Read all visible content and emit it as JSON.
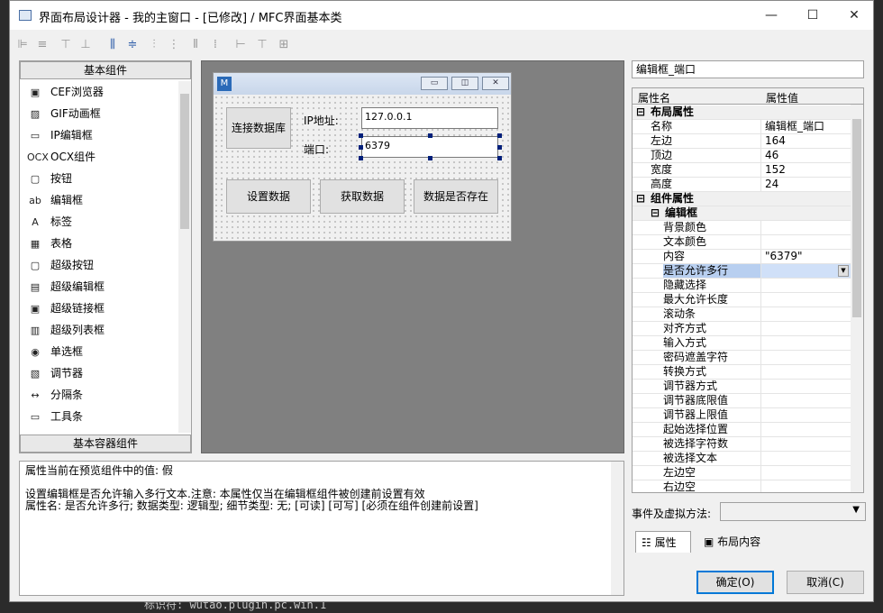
{
  "background_terminal": {
    "text": "标识符: wutao.plugin.pc.win.1"
  },
  "window": {
    "title": "界面布局设计器 - 我的主窗口 - [已修改] / MFC界面基本类"
  },
  "left_panel": {
    "header": "基本组件",
    "footer": "基本容器组件",
    "items": [
      {
        "icon": "▣",
        "label": "CEF浏览器"
      },
      {
        "icon": "▨",
        "label": "GIF动画框"
      },
      {
        "icon": "▭",
        "label": "IP编辑框"
      },
      {
        "icon": "OCX",
        "label": "OCX组件"
      },
      {
        "icon": "▢",
        "label": "按钮"
      },
      {
        "icon": "ab",
        "label": "编辑框"
      },
      {
        "icon": "A",
        "label": "标签"
      },
      {
        "icon": "▦",
        "label": "表格"
      },
      {
        "icon": "▢",
        "label": "超级按钮"
      },
      {
        "icon": "▤",
        "label": "超级编辑框"
      },
      {
        "icon": "▣",
        "label": "超级链接框"
      },
      {
        "icon": "▥",
        "label": "超级列表框"
      },
      {
        "icon": "◉",
        "label": "单选框"
      },
      {
        "icon": "▧",
        "label": "调节器"
      },
      {
        "icon": "↔",
        "label": "分隔条"
      },
      {
        "icon": "▭",
        "label": "工具条"
      }
    ]
  },
  "design_form": {
    "connect_button": "连接数据库",
    "ip_label": "IP地址:",
    "ip_value": "127.0.0.1",
    "port_label": "端口:",
    "port_value": "6379",
    "set_button": "设置数据",
    "get_button": "获取数据",
    "exists_button": "数据是否存在"
  },
  "description": {
    "line1": "属性当前在预览组件中的值: 假",
    "line2": "设置编辑框是否允许输入多行文本.注意: 本属性仅当在编辑框组件被创建前设置有效",
    "line3": "属性名: 是否允许多行; 数据类型: 逻辑型; 细节类型: 无; [可读] [可写] [必须在组件创建前设置]"
  },
  "right_panel": {
    "component_name": "编辑框_端口",
    "col_name": "属性名",
    "col_value": "属性值",
    "rows": [
      {
        "kind": "grp",
        "toggle": "⊟",
        "name": "布局属性",
        "value": ""
      },
      {
        "kind": "p",
        "name": "名称",
        "value": "编辑框_端口"
      },
      {
        "kind": "p",
        "name": "左边",
        "value": "164"
      },
      {
        "kind": "p",
        "name": "顶边",
        "value": "46"
      },
      {
        "kind": "p",
        "name": "宽度",
        "value": "152"
      },
      {
        "kind": "p",
        "name": "高度",
        "value": "24"
      },
      {
        "kind": "grp",
        "toggle": "⊟",
        "name": "组件属性",
        "value": ""
      },
      {
        "kind": "sub",
        "toggle": "⊟",
        "name": "编辑框",
        "value": ""
      },
      {
        "kind": "pp",
        "name": "背景颜色",
        "value": ""
      },
      {
        "kind": "pp",
        "name": "文本颜色",
        "value": ""
      },
      {
        "kind": "pp",
        "name": "内容",
        "value": "\"6379\""
      },
      {
        "kind": "sel",
        "name": "是否允许多行",
        "value": ""
      },
      {
        "kind": "pp",
        "name": "隐藏选择",
        "value": ""
      },
      {
        "kind": "pp",
        "name": "最大允许长度",
        "value": ""
      },
      {
        "kind": "pp",
        "name": "滚动条",
        "value": ""
      },
      {
        "kind": "pp",
        "name": "对齐方式",
        "value": ""
      },
      {
        "kind": "pp",
        "name": "输入方式",
        "value": ""
      },
      {
        "kind": "pp",
        "name": "密码遮盖字符",
        "value": ""
      },
      {
        "kind": "pp",
        "name": "转换方式",
        "value": ""
      },
      {
        "kind": "pp",
        "name": "调节器方式",
        "value": ""
      },
      {
        "kind": "pp",
        "name": "调节器底限值",
        "value": ""
      },
      {
        "kind": "pp",
        "name": "调节器上限值",
        "value": ""
      },
      {
        "kind": "pp",
        "name": "起始选择位置",
        "value": ""
      },
      {
        "kind": "pp",
        "name": "被选择字符数",
        "value": ""
      },
      {
        "kind": "pp",
        "name": "被选择文本",
        "value": ""
      },
      {
        "kind": "pp",
        "name": "左边空",
        "value": ""
      },
      {
        "kind": "pp",
        "name": "右边空",
        "value": ""
      }
    ],
    "events_label": "事件及虚拟方法:",
    "tab_properties": "属性",
    "tab_layout": "布局内容",
    "ok_button": "确定(O)",
    "cancel_button": "取消(C)"
  }
}
